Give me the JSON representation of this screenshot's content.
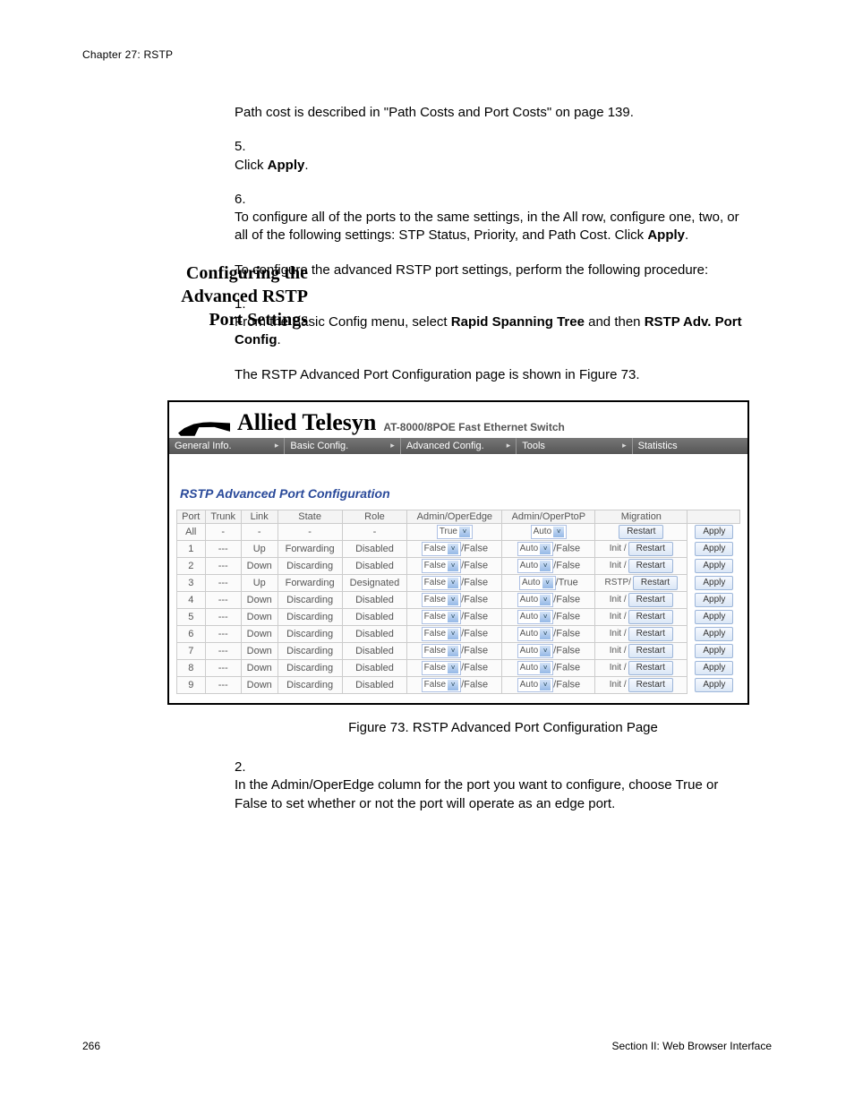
{
  "chapter_line": "Chapter 27: RSTP",
  "intro": {
    "path_cost": "Path cost is described in \"Path Costs and Port Costs\" on page 139.",
    "step5_num": "5.",
    "step5_a": "Click ",
    "step5_b": "Apply",
    "step5_c": ".",
    "step6_num": "6.",
    "step6_a": "To configure all of the ports to the same settings, in the All row, configure one, two, or all of the following settings: STP Status, Priority, and Path Cost. Click ",
    "step6_b": "Apply",
    "step6_c": "."
  },
  "section_heading": "Configuring the Advanced RSTP Port Settings",
  "section_intro": "To configure the advanced RSTP port settings, perform the following procedure:",
  "step1": {
    "num": "1.",
    "a": "From the Basic Config menu, select ",
    "b1": "Rapid Spanning Tree",
    "mid": " and then ",
    "b2": "RSTP Adv. Port Config",
    "c": "."
  },
  "preshot": "The RSTP Advanced Port Configuration page is shown in Figure 73.",
  "screenshot": {
    "brand": "Allied Telesyn",
    "brand_sub": "AT-8000/8POE Fast Ethernet Switch",
    "menus": [
      "General Info.",
      "Basic Config.",
      "Advanced Config.",
      "Tools",
      "Statistics"
    ],
    "panel_title": "RSTP Advanced Port Configuration",
    "headers": [
      "Port",
      "Trunk",
      "Link",
      "State",
      "Role",
      "Admin/OperEdge",
      "Admin/OperPtoP",
      "Migration"
    ],
    "apply_label": "Apply",
    "restart_label": "Restart",
    "rows": [
      {
        "port": "All",
        "trunk": "-",
        "link": "-",
        "state": "-",
        "role": "-",
        "edge_sel": "True",
        "edge_suffix": "",
        "ptop_sel": "Auto",
        "ptop_suffix": "",
        "mig_label": "",
        "restart": "Restart",
        "apply": "Apply"
      },
      {
        "port": "1",
        "trunk": "---",
        "link": "Up",
        "state": "Forwarding",
        "role": "Disabled",
        "edge_sel": "False",
        "edge_suffix": "/False",
        "ptop_sel": "Auto",
        "ptop_suffix": "/False",
        "mig_label": "Init /",
        "restart": "Restart",
        "apply": "Apply"
      },
      {
        "port": "2",
        "trunk": "---",
        "link": "Down",
        "state": "Discarding",
        "role": "Disabled",
        "edge_sel": "False",
        "edge_suffix": "/False",
        "ptop_sel": "Auto",
        "ptop_suffix": "/False",
        "mig_label": "Init /",
        "restart": "Restart",
        "apply": "Apply"
      },
      {
        "port": "3",
        "trunk": "---",
        "link": "Up",
        "state": "Forwarding",
        "role": "Designated",
        "edge_sel": "False",
        "edge_suffix": "/False",
        "ptop_sel": "Auto",
        "ptop_suffix": "/True",
        "mig_label": "RSTP/",
        "restart": "Restart",
        "apply": "Apply"
      },
      {
        "port": "4",
        "trunk": "---",
        "link": "Down",
        "state": "Discarding",
        "role": "Disabled",
        "edge_sel": "False",
        "edge_suffix": "/False",
        "ptop_sel": "Auto",
        "ptop_suffix": "/False",
        "mig_label": "Init /",
        "restart": "Restart",
        "apply": "Apply"
      },
      {
        "port": "5",
        "trunk": "---",
        "link": "Down",
        "state": "Discarding",
        "role": "Disabled",
        "edge_sel": "False",
        "edge_suffix": "/False",
        "ptop_sel": "Auto",
        "ptop_suffix": "/False",
        "mig_label": "Init /",
        "restart": "Restart",
        "apply": "Apply"
      },
      {
        "port": "6",
        "trunk": "---",
        "link": "Down",
        "state": "Discarding",
        "role": "Disabled",
        "edge_sel": "False",
        "edge_suffix": "/False",
        "ptop_sel": "Auto",
        "ptop_suffix": "/False",
        "mig_label": "Init /",
        "restart": "Restart",
        "apply": "Apply"
      },
      {
        "port": "7",
        "trunk": "---",
        "link": "Down",
        "state": "Discarding",
        "role": "Disabled",
        "edge_sel": "False",
        "edge_suffix": "/False",
        "ptop_sel": "Auto",
        "ptop_suffix": "/False",
        "mig_label": "Init /",
        "restart": "Restart",
        "apply": "Apply"
      },
      {
        "port": "8",
        "trunk": "---",
        "link": "Down",
        "state": "Discarding",
        "role": "Disabled",
        "edge_sel": "False",
        "edge_suffix": "/False",
        "ptop_sel": "Auto",
        "ptop_suffix": "/False",
        "mig_label": "Init /",
        "restart": "Restart",
        "apply": "Apply"
      },
      {
        "port": "9",
        "trunk": "---",
        "link": "Down",
        "state": "Discarding",
        "role": "Disabled",
        "edge_sel": "False",
        "edge_suffix": "/False",
        "ptop_sel": "Auto",
        "ptop_suffix": "/False",
        "mig_label": "Init /",
        "restart": "Restart",
        "apply": "Apply"
      }
    ]
  },
  "fig_caption": "Figure 73. RSTP Advanced Port Configuration Page",
  "step2": {
    "num": "2.",
    "text": "In the Admin/OperEdge column for the port you want to configure, choose True or False to set whether or not the port will operate as an edge port."
  },
  "footer": {
    "page": "266",
    "section": "Section II: Web Browser Interface"
  }
}
